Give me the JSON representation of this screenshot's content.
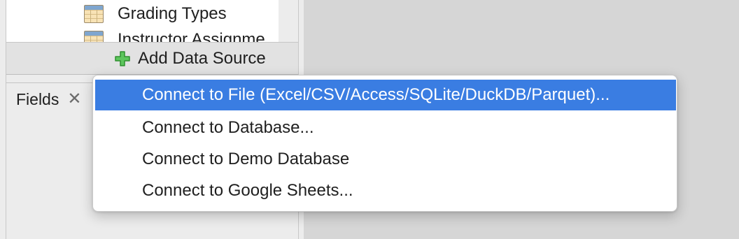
{
  "data_sources_tree": {
    "items": [
      {
        "label": "Grading Types",
        "icon": "table-icon"
      },
      {
        "label": "Instructor Assignme",
        "icon": "table-icon"
      }
    ]
  },
  "add_data_source": {
    "label": "Add Data Source",
    "icon": "green-plus-icon",
    "icon_color": "#4cb84c"
  },
  "fields_panel": {
    "tab_label": "Fields",
    "close_glyph": "✕"
  },
  "dropdown_menu": {
    "highlight_color": "#3a7de2",
    "items": [
      {
        "label": "Connect to File (Excel/CSV/Access/SQLite/DuckDB/Parquet)...",
        "highlighted": true
      },
      {
        "label": "Connect to Database...",
        "highlighted": false
      },
      {
        "label": "Connect to Demo Database",
        "highlighted": false
      },
      {
        "label": "Connect to Google Sheets...",
        "highlighted": false
      }
    ]
  }
}
